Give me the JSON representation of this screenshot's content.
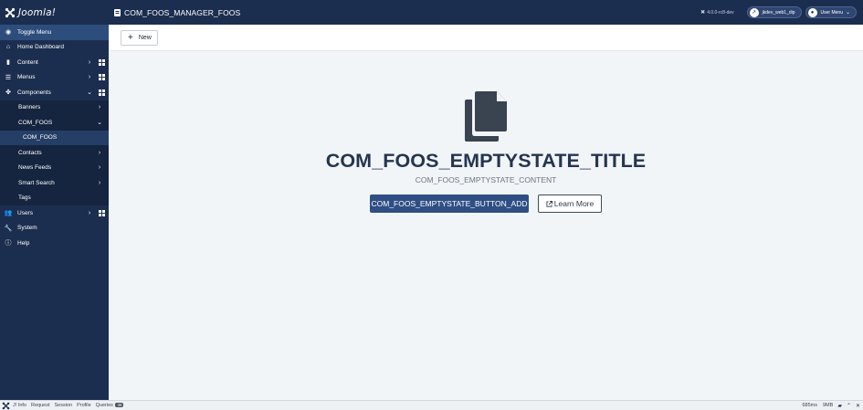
{
  "header": {
    "logo_text": "Joomla!",
    "page_title": "COM_FOOS_MANAGER_FOOS",
    "version": "4.0.0-rc8-dev",
    "site_button": "jkdev_web1_dip",
    "user_menu": "User Menu"
  },
  "sidebar": {
    "items": [
      {
        "label": "Toggle Menu",
        "icon": "toggle-icon"
      },
      {
        "label": "Home Dashboard",
        "icon": "home-icon"
      },
      {
        "label": "Content",
        "icon": "file-icon"
      },
      {
        "label": "Menus",
        "icon": "list-icon"
      },
      {
        "label": "Components",
        "icon": "puzzle-icon"
      },
      {
        "label": "Users",
        "icon": "users-icon"
      },
      {
        "label": "System",
        "icon": "wrench-icon"
      },
      {
        "label": "Help",
        "icon": "info-icon"
      }
    ],
    "sub_items": [
      {
        "label": "Banners"
      },
      {
        "label": "COM_FOOS"
      },
      {
        "label": "COM_FOOS"
      },
      {
        "label": "Contacts"
      },
      {
        "label": "News Feeds"
      },
      {
        "label": "Smart Search"
      },
      {
        "label": "Tags"
      }
    ]
  },
  "toolbar": {
    "new_label": "New"
  },
  "empty_state": {
    "title": "COM_FOOS_EMPTYSTATE_TITLE",
    "content": "COM_FOOS_EMPTYSTATE_CONTENT",
    "add_button": "COM_FOOS_EMPTYSTATE_BUTTON_ADD",
    "learn_more": "Learn More"
  },
  "debug": {
    "tabs": [
      "J! Info",
      "Request",
      "Session",
      "Profile",
      "Queries"
    ],
    "queries_count": "36",
    "time": "685ms",
    "memory": "9MB"
  },
  "colors": {
    "header_bg": "#1c2e4f",
    "sidebar_bg": "#1c2e4f",
    "primary_button": "#2f4f84",
    "title_color": "#253550"
  }
}
